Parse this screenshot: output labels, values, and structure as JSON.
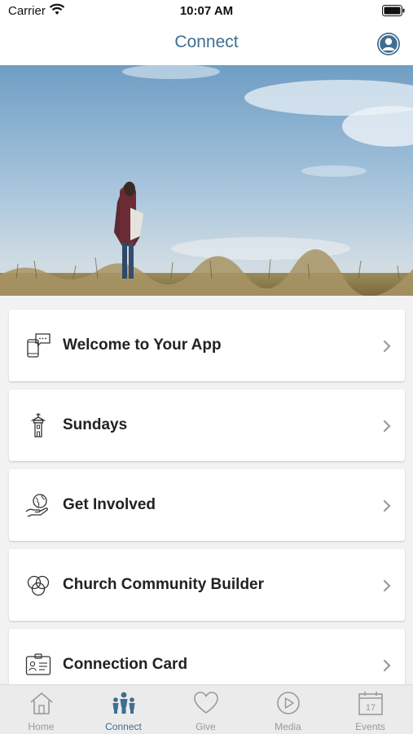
{
  "status_bar": {
    "carrier": "Carrier",
    "time": "10:07 AM"
  },
  "header": {
    "title": "Connect"
  },
  "menu": {
    "items": [
      {
        "label": "Welcome to Your App",
        "icon": "phone-chat-icon"
      },
      {
        "label": "Sundays",
        "icon": "church-steeple-icon"
      },
      {
        "label": "Get Involved",
        "icon": "hand-globe-icon"
      },
      {
        "label": "Church Community Builder",
        "icon": "circles-icon"
      },
      {
        "label": "Connection Card",
        "icon": "id-card-icon"
      }
    ]
  },
  "tab_bar": {
    "tabs": [
      {
        "label": "Home",
        "icon": "home-icon"
      },
      {
        "label": "Connect",
        "icon": "people-icon",
        "active": true
      },
      {
        "label": "Give",
        "icon": "heart-icon"
      },
      {
        "label": "Media",
        "icon": "play-icon"
      },
      {
        "label": "Events",
        "icon": "calendar-icon"
      }
    ],
    "calendar_day": "17"
  },
  "colors": {
    "accent": "#3f6e91",
    "inactive": "#9a9a9a"
  }
}
